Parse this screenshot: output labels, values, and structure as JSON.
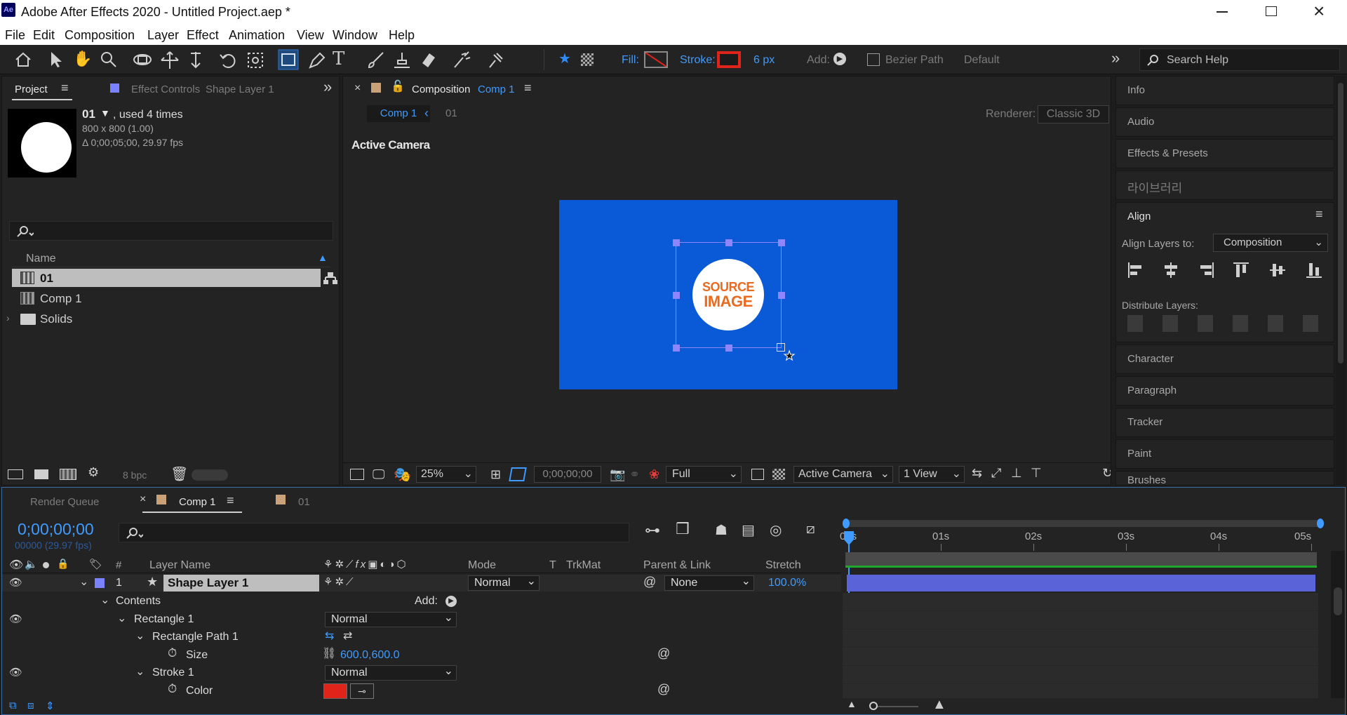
{
  "app": {
    "title": "Adobe After Effects 2020 - Untitled Project.aep *",
    "logo": "Ae"
  },
  "menu": [
    "File",
    "Edit",
    "Composition",
    "Layer",
    "Effect",
    "Animation",
    "View",
    "Window",
    "Help"
  ],
  "toolbar": {
    "fill_label": "Fill:",
    "stroke_label": "Stroke:",
    "stroke_width": "6 px",
    "add_label": "Add:",
    "bezier_label": "Bezier Path",
    "workspace": "Default",
    "search_placeholder": "Search Help",
    "stroke_color": "#e0241a"
  },
  "project": {
    "tab": "Project",
    "effect_tab": "Effect Controls",
    "effect_target": "Shape Layer 1",
    "item_name": "01",
    "used": ", used 4 times",
    "dimensions": "800 x 800 (1.00)",
    "duration": "Δ 0;00;05;00, 29.97 fps",
    "col_name": "Name",
    "items": [
      "01",
      "Comp 1",
      "Solids"
    ],
    "bpc": "8 bpc"
  },
  "composition": {
    "tab": "Composition",
    "comp_name": "Comp 1",
    "crumb_current": "Comp 1",
    "crumb_next": "01",
    "renderer_label": "Renderer:",
    "renderer": "Classic 3D",
    "camera_label": "Active Camera",
    "zoom": "25%",
    "timecode": "0;00;00;00",
    "resolution": "Full",
    "camera": "Active Camera",
    "views": "1 View",
    "bg_color": "#0a5ad8",
    "badge_line1": "SOURCE",
    "badge_line2": "IMAGE",
    "badge_color": "#ea6a20"
  },
  "right_panels": {
    "info": "Info",
    "audio": "Audio",
    "effects": "Effects & Presets",
    "library": "라이브러리",
    "align": "Align",
    "align_to_label": "Align Layers to:",
    "align_to_value": "Composition",
    "distribute_label": "Distribute Layers:",
    "character": "Character",
    "paragraph": "Paragraph",
    "tracker": "Tracker",
    "paint": "Paint",
    "brushes": "Brushes"
  },
  "timeline": {
    "render_queue": "Render Queue",
    "comp_tab": "Comp 1",
    "comp_tab2": "01",
    "timecode": "0;00;00;00",
    "fps": "00000 (29.97 fps)",
    "headers": {
      "num": "#",
      "layer": "Layer Name",
      "mode": "Mode",
      "t": "T",
      "trkmat": "TrkMat",
      "parent": "Parent & Link",
      "stretch": "Stretch"
    },
    "layer": {
      "num": "1",
      "name": "Shape Layer 1",
      "mode": "Normal",
      "parent": "None",
      "stretch": "100.0%"
    },
    "contents": "Contents",
    "add_label": "Add:",
    "rect": "Rectangle 1",
    "rect_mode": "Normal",
    "rect_path": "Rectangle Path 1",
    "size_label": "Size",
    "size_value": "600.0,600.0",
    "stroke": "Stroke 1",
    "stroke_mode": "Normal",
    "color_label": "Color",
    "color_value": "#e0241a",
    "ruler": [
      "00s",
      "01s",
      "02s",
      "03s",
      "04s",
      "05s"
    ]
  }
}
